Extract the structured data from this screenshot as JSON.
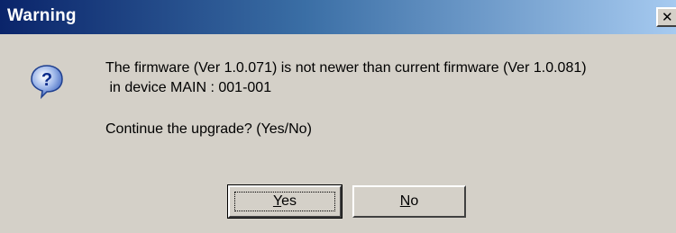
{
  "window": {
    "title": "Warning",
    "close_symbol": "✕"
  },
  "message": {
    "icon": "question-icon",
    "line1": "The firmware (Ver 1.0.071) is not newer than current firmware (Ver 1.0.081)",
    "line2": " in device MAIN : 001-001",
    "prompt": "Continue the upgrade? (Yes/No)"
  },
  "buttons": {
    "yes": {
      "mnemonic": "Y",
      "rest": "es"
    },
    "no": {
      "mnemonic": "N",
      "rest": "o"
    }
  },
  "colors": {
    "titlebar_start": "#0a246a",
    "titlebar_end": "#a6caf0",
    "dialog_face": "#d4d0c8"
  }
}
